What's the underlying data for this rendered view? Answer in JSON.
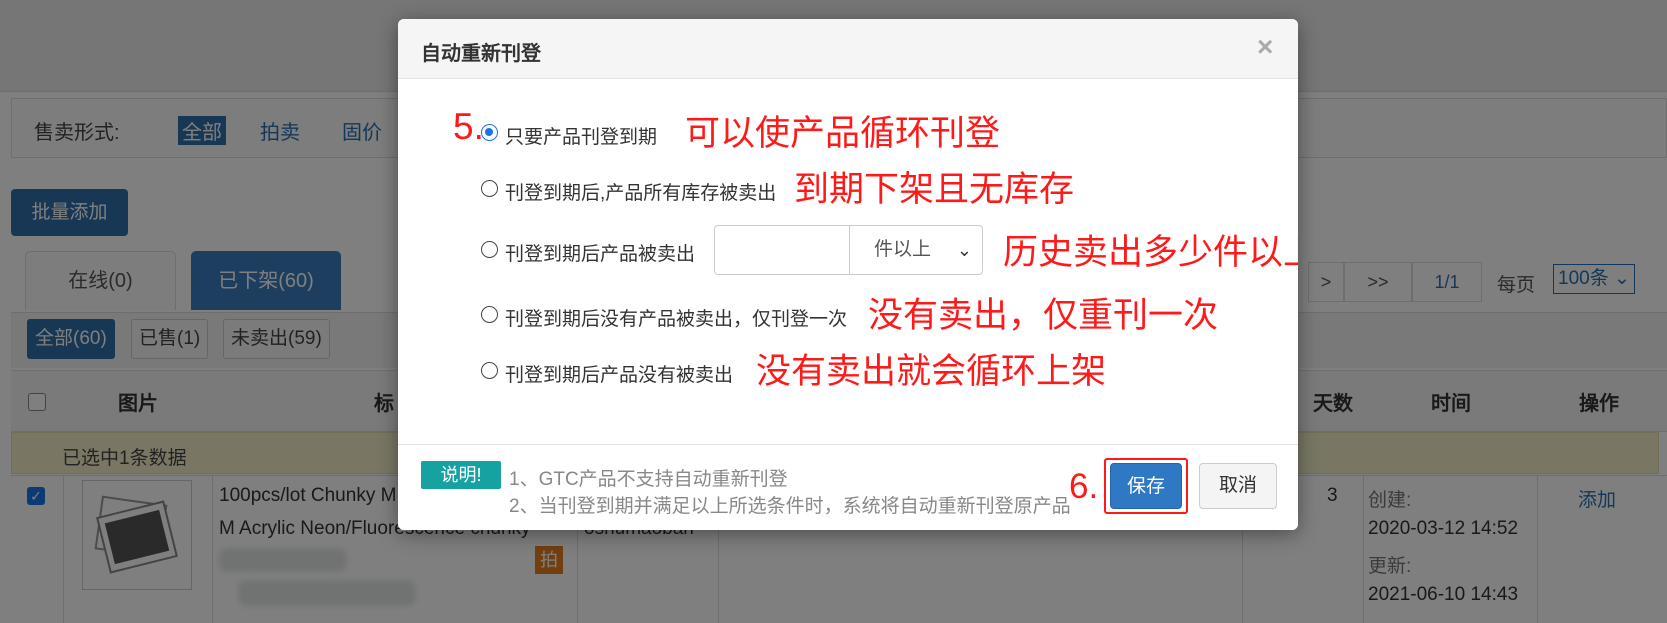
{
  "background": {
    "filter": {
      "label": "售卖形式:",
      "options": [
        "全部",
        "拍卖",
        "固价"
      ]
    },
    "batch_add_label": "批量添加",
    "tabs": {
      "online": "在线(0)",
      "offline": "已下架(60)"
    },
    "pager": {
      "next": ">",
      "last": ">>",
      "page": "1/1",
      "per_page_label": "每页",
      "per_page_value": "100条"
    },
    "sub_filters": [
      "全部(60)",
      "已售(1)",
      "未卖出(59)"
    ],
    "columns": {
      "image": "图片",
      "title": "标",
      "days": "天数",
      "time": "时间",
      "action": "操作"
    },
    "selection_info": "已选中1条数据",
    "row": {
      "title_line1": "100pcs/lot Chunky M",
      "title_line2": "M Acrylic Neon/Fluorescence chunky",
      "store": "oshumaoban",
      "badge": "拍",
      "days": "3",
      "created_label": "创建:",
      "created": "2020-03-12 14:52",
      "updated_label": "更新:",
      "updated": "2021-06-10 14:43",
      "action": "添加"
    }
  },
  "modal": {
    "title": "自动重新刊登",
    "close": "×",
    "options": [
      {
        "label": "只要产品刊登到期",
        "annotation": "可以使产品循环刊登",
        "checked": true
      },
      {
        "label": "刊登到期后,产品所有库存被卖出",
        "annotation": "到期下架且无库存",
        "checked": false
      },
      {
        "label": "刊登到期后产品被卖出",
        "annotation": "历史卖出多少件以上才会执行重刊",
        "checked": false,
        "input_value": "",
        "select_value": "件以上"
      },
      {
        "label": "刊登到期后没有产品被卖出，仅刊登一次",
        "annotation": "没有卖出，仅重刊一次",
        "checked": false
      },
      {
        "label": "刊登到期后产品没有被卖出",
        "annotation": "没有卖出就会循环上架",
        "checked": false
      }
    ],
    "step_labels": {
      "step5": "5.",
      "step6": "6."
    },
    "note_badge": "说明!",
    "notes": [
      "1、GTC产品不支持自动重新刊登",
      "2、当刊登到期并满足以上所选条件时，系统将自动重新刊登原产品"
    ],
    "save_label": "保存",
    "cancel_label": "取消"
  },
  "colors": {
    "primary": "#2f78c4",
    "annotation_red": "#ff1a1a",
    "note_teal": "#17a2a2"
  }
}
